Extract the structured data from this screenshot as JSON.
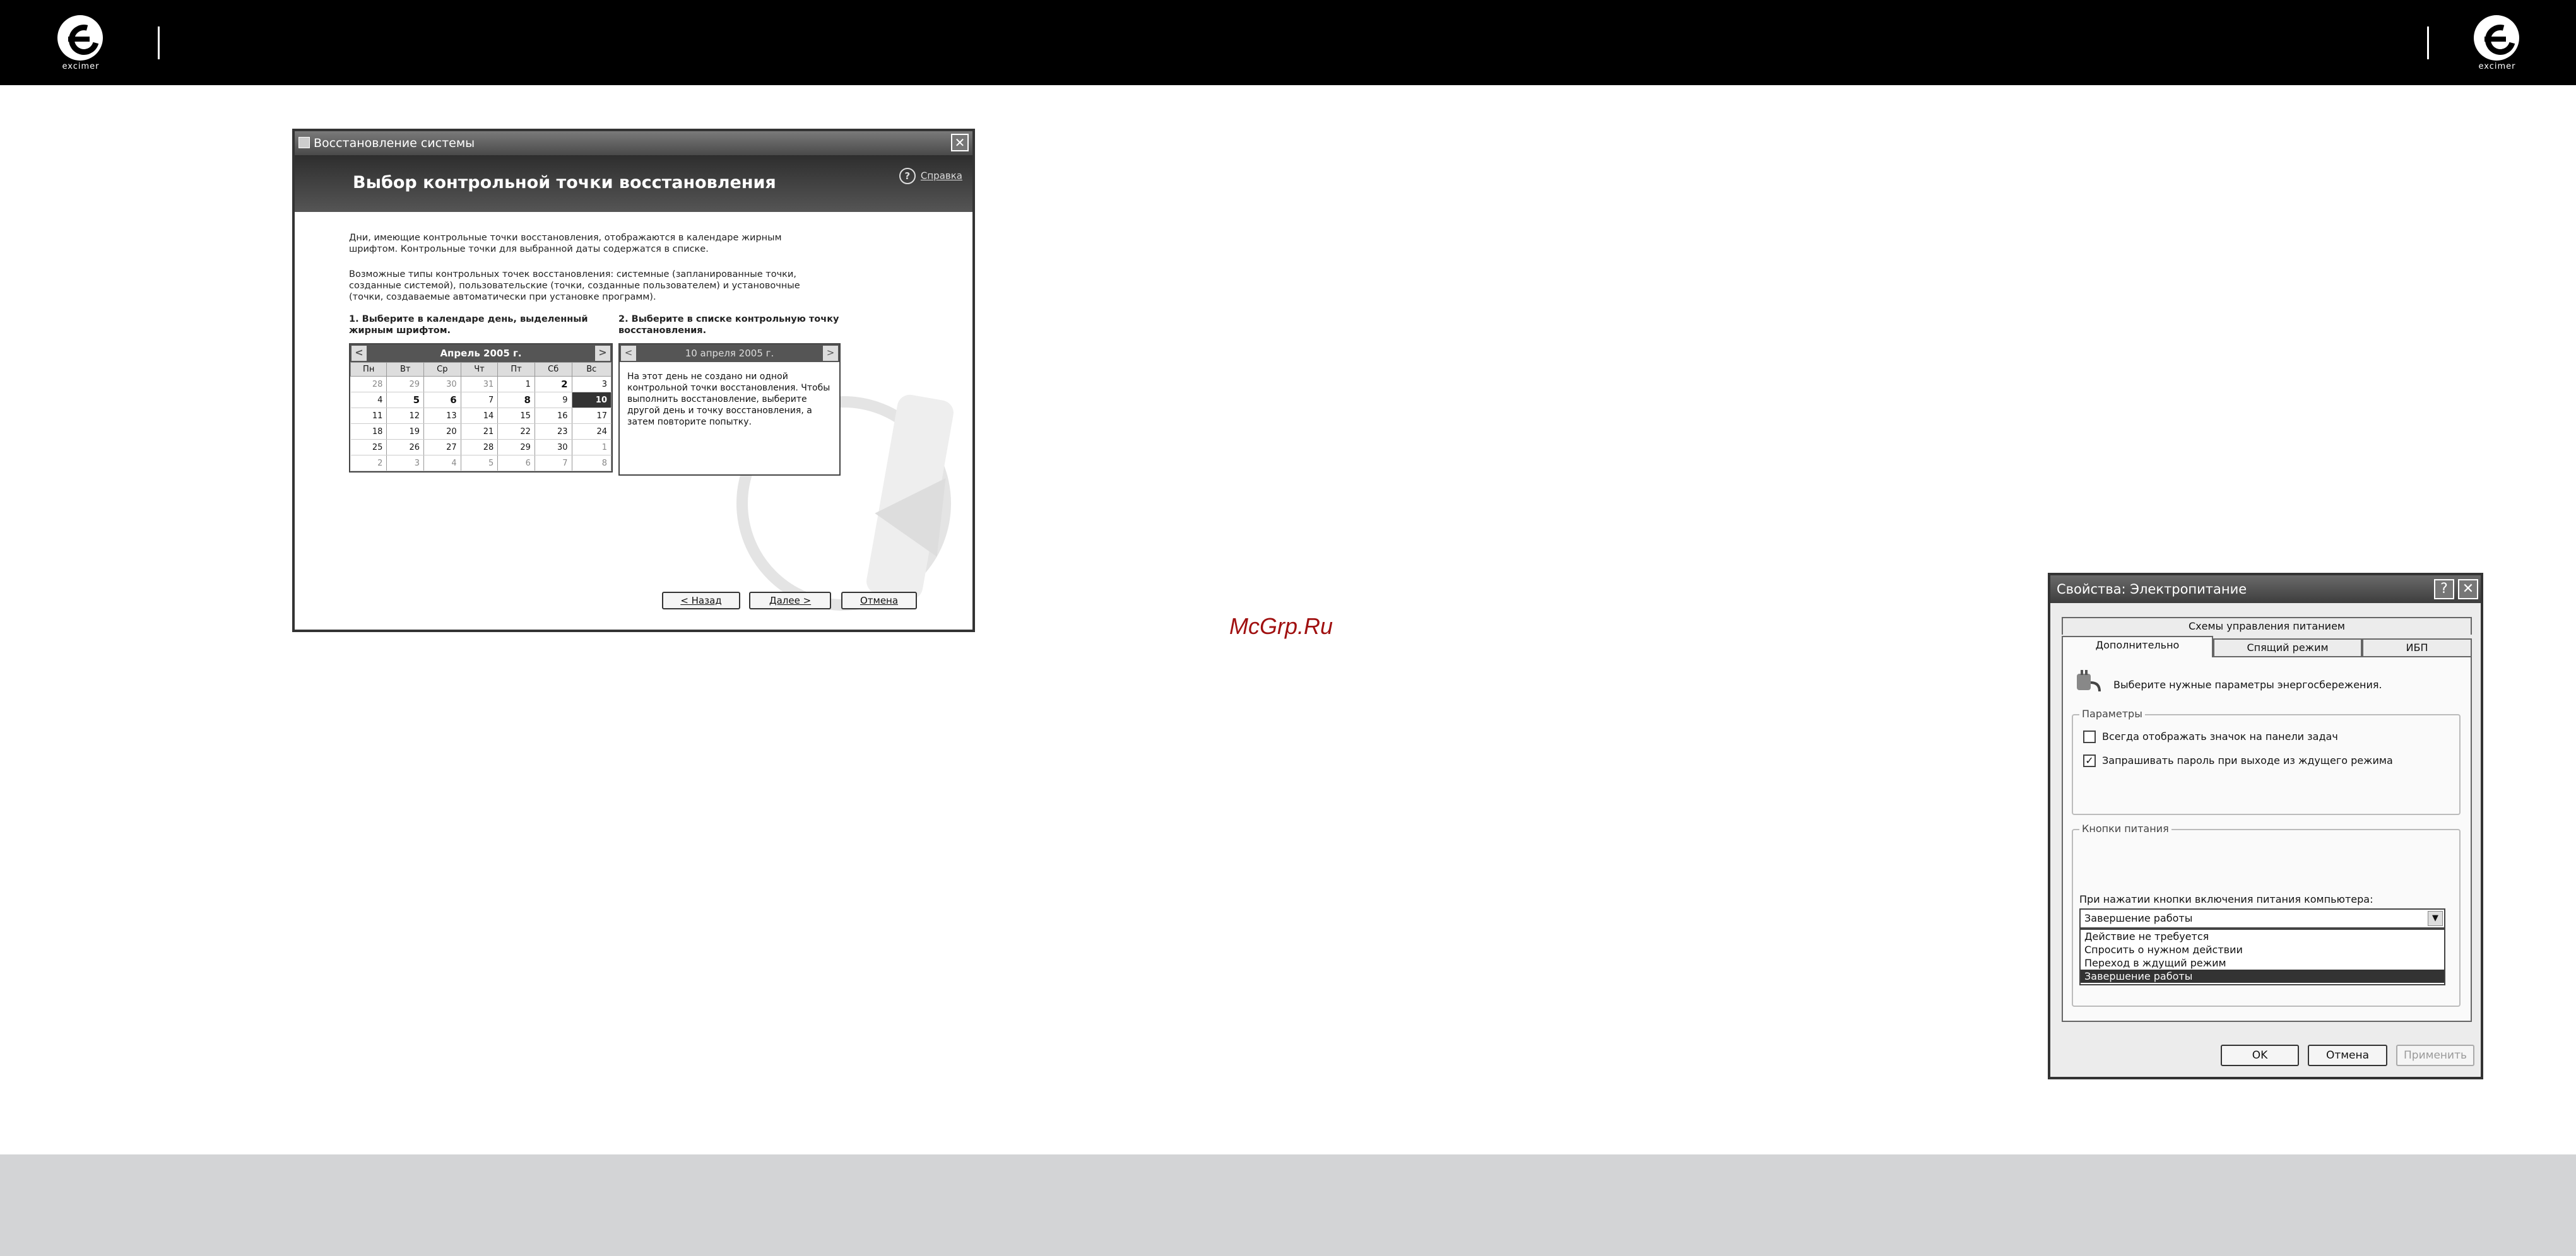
{
  "restore_window": {
    "title": "Восстановление системы",
    "heading": "Выбор контрольной точки восстановления",
    "help_label": "Справка",
    "intro": "Дни, имеющие контрольные точки восстановления, отображаются в календаре жирным шрифтом. Контрольные точки для выбранной даты содержатся в списке.",
    "types_text": "Возможные типы контрольных точек восстановления: системные (запланированные точки, созданные системой), пользовательские (точки, созданные пользователем) и установочные (точки, создаваемые автоматически при установке программ).",
    "step1": "1. Выберите в календаре день, выделенный жирным шрифтом.",
    "step2": "2. Выберите в списке контрольную точку восстановления.",
    "calendar": {
      "month": "Апрель 2005 г.",
      "days": [
        "Пн",
        "Вт",
        "Ср",
        "Чт",
        "Пт",
        "Сб",
        "Вс"
      ],
      "weeks": [
        [
          "28",
          "29",
          "30",
          "31",
          "1",
          "2",
          "3"
        ],
        [
          "4",
          "5",
          "6",
          "7",
          "8",
          "9",
          "10"
        ],
        [
          "11",
          "12",
          "13",
          "14",
          "15",
          "16",
          "17"
        ],
        [
          "18",
          "19",
          "20",
          "21",
          "22",
          "23",
          "24"
        ],
        [
          "25",
          "26",
          "27",
          "28",
          "29",
          "30",
          "1"
        ],
        [
          "2",
          "3",
          "4",
          "5",
          "6",
          "7",
          "8"
        ]
      ]
    },
    "list": {
      "date": "10 апреля 2005 г.",
      "message": "На этот день не создано ни одной контрольной точки восстановления. Чтобы выполнить восстановление, выберите другой день и точку восстановления, а затем повторите попытку."
    },
    "buttons": {
      "back": "< Назад",
      "next": "Далее >",
      "cancel": "Отмена"
    }
  },
  "power_window": {
    "title": "Свойства: Электропитание",
    "help_btn": "?",
    "tabs": {
      "schemes": "Схемы управления питанием",
      "advanced": "Дополнительно",
      "sleep": "Спящий режим",
      "ups": "ИБП"
    },
    "prompt": "Выберите нужные параметры энергосбережения.",
    "params_legend": "Параметры",
    "opt_tray": "Всегда отображать значок на панели задач",
    "opt_password": "Запрашивать пароль при выходе из ждущего режима",
    "buttons_legend": "Кнопки питания",
    "power_button_label": "При нажатии кнопки включения питания компьютера:",
    "selected": "Завершение работы",
    "options": [
      "Действие не требуется",
      "Спросить о нужном действии",
      "Переход в ждущий режим",
      "Завершение работы"
    ],
    "ok": "OK",
    "cancel": "Отмена",
    "apply": "Применить"
  },
  "watermark": "McGrp.Ru",
  "logo_word": "excimer",
  "colors": {
    "header": "#000000",
    "footer": "#d3d4d6",
    "watermark": "#a01010"
  }
}
